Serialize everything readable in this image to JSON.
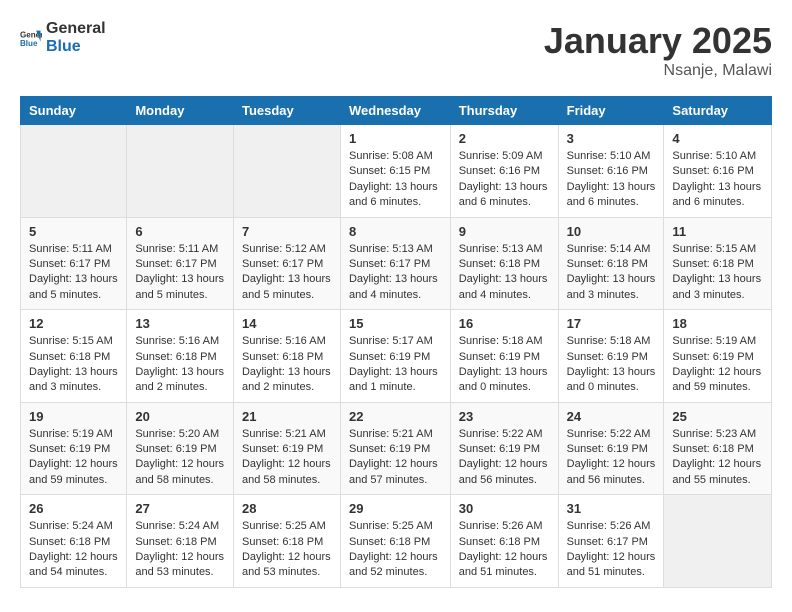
{
  "header": {
    "logo_general": "General",
    "logo_blue": "Blue",
    "month_title": "January 2025",
    "location": "Nsanje, Malawi"
  },
  "weekdays": [
    "Sunday",
    "Monday",
    "Tuesday",
    "Wednesday",
    "Thursday",
    "Friday",
    "Saturday"
  ],
  "weeks": [
    [
      {
        "day": "",
        "sunrise": "",
        "sunset": "",
        "daylight": ""
      },
      {
        "day": "",
        "sunrise": "",
        "sunset": "",
        "daylight": ""
      },
      {
        "day": "",
        "sunrise": "",
        "sunset": "",
        "daylight": ""
      },
      {
        "day": "1",
        "sunrise": "Sunrise: 5:08 AM",
        "sunset": "Sunset: 6:15 PM",
        "daylight": "Daylight: 13 hours and 6 minutes."
      },
      {
        "day": "2",
        "sunrise": "Sunrise: 5:09 AM",
        "sunset": "Sunset: 6:16 PM",
        "daylight": "Daylight: 13 hours and 6 minutes."
      },
      {
        "day": "3",
        "sunrise": "Sunrise: 5:10 AM",
        "sunset": "Sunset: 6:16 PM",
        "daylight": "Daylight: 13 hours and 6 minutes."
      },
      {
        "day": "4",
        "sunrise": "Sunrise: 5:10 AM",
        "sunset": "Sunset: 6:16 PM",
        "daylight": "Daylight: 13 hours and 6 minutes."
      }
    ],
    [
      {
        "day": "5",
        "sunrise": "Sunrise: 5:11 AM",
        "sunset": "Sunset: 6:17 PM",
        "daylight": "Daylight: 13 hours and 5 minutes."
      },
      {
        "day": "6",
        "sunrise": "Sunrise: 5:11 AM",
        "sunset": "Sunset: 6:17 PM",
        "daylight": "Daylight: 13 hours and 5 minutes."
      },
      {
        "day": "7",
        "sunrise": "Sunrise: 5:12 AM",
        "sunset": "Sunset: 6:17 PM",
        "daylight": "Daylight: 13 hours and 5 minutes."
      },
      {
        "day": "8",
        "sunrise": "Sunrise: 5:13 AM",
        "sunset": "Sunset: 6:17 PM",
        "daylight": "Daylight: 13 hours and 4 minutes."
      },
      {
        "day": "9",
        "sunrise": "Sunrise: 5:13 AM",
        "sunset": "Sunset: 6:18 PM",
        "daylight": "Daylight: 13 hours and 4 minutes."
      },
      {
        "day": "10",
        "sunrise": "Sunrise: 5:14 AM",
        "sunset": "Sunset: 6:18 PM",
        "daylight": "Daylight: 13 hours and 3 minutes."
      },
      {
        "day": "11",
        "sunrise": "Sunrise: 5:15 AM",
        "sunset": "Sunset: 6:18 PM",
        "daylight": "Daylight: 13 hours and 3 minutes."
      }
    ],
    [
      {
        "day": "12",
        "sunrise": "Sunrise: 5:15 AM",
        "sunset": "Sunset: 6:18 PM",
        "daylight": "Daylight: 13 hours and 3 minutes."
      },
      {
        "day": "13",
        "sunrise": "Sunrise: 5:16 AM",
        "sunset": "Sunset: 6:18 PM",
        "daylight": "Daylight: 13 hours and 2 minutes."
      },
      {
        "day": "14",
        "sunrise": "Sunrise: 5:16 AM",
        "sunset": "Sunset: 6:18 PM",
        "daylight": "Daylight: 13 hours and 2 minutes."
      },
      {
        "day": "15",
        "sunrise": "Sunrise: 5:17 AM",
        "sunset": "Sunset: 6:19 PM",
        "daylight": "Daylight: 13 hours and 1 minute."
      },
      {
        "day": "16",
        "sunrise": "Sunrise: 5:18 AM",
        "sunset": "Sunset: 6:19 PM",
        "daylight": "Daylight: 13 hours and 0 minutes."
      },
      {
        "day": "17",
        "sunrise": "Sunrise: 5:18 AM",
        "sunset": "Sunset: 6:19 PM",
        "daylight": "Daylight: 13 hours and 0 minutes."
      },
      {
        "day": "18",
        "sunrise": "Sunrise: 5:19 AM",
        "sunset": "Sunset: 6:19 PM",
        "daylight": "Daylight: 12 hours and 59 minutes."
      }
    ],
    [
      {
        "day": "19",
        "sunrise": "Sunrise: 5:19 AM",
        "sunset": "Sunset: 6:19 PM",
        "daylight": "Daylight: 12 hours and 59 minutes."
      },
      {
        "day": "20",
        "sunrise": "Sunrise: 5:20 AM",
        "sunset": "Sunset: 6:19 PM",
        "daylight": "Daylight: 12 hours and 58 minutes."
      },
      {
        "day": "21",
        "sunrise": "Sunrise: 5:21 AM",
        "sunset": "Sunset: 6:19 PM",
        "daylight": "Daylight: 12 hours and 58 minutes."
      },
      {
        "day": "22",
        "sunrise": "Sunrise: 5:21 AM",
        "sunset": "Sunset: 6:19 PM",
        "daylight": "Daylight: 12 hours and 57 minutes."
      },
      {
        "day": "23",
        "sunrise": "Sunrise: 5:22 AM",
        "sunset": "Sunset: 6:19 PM",
        "daylight": "Daylight: 12 hours and 56 minutes."
      },
      {
        "day": "24",
        "sunrise": "Sunrise: 5:22 AM",
        "sunset": "Sunset: 6:19 PM",
        "daylight": "Daylight: 12 hours and 56 minutes."
      },
      {
        "day": "25",
        "sunrise": "Sunrise: 5:23 AM",
        "sunset": "Sunset: 6:18 PM",
        "daylight": "Daylight: 12 hours and 55 minutes."
      }
    ],
    [
      {
        "day": "26",
        "sunrise": "Sunrise: 5:24 AM",
        "sunset": "Sunset: 6:18 PM",
        "daylight": "Daylight: 12 hours and 54 minutes."
      },
      {
        "day": "27",
        "sunrise": "Sunrise: 5:24 AM",
        "sunset": "Sunset: 6:18 PM",
        "daylight": "Daylight: 12 hours and 53 minutes."
      },
      {
        "day": "28",
        "sunrise": "Sunrise: 5:25 AM",
        "sunset": "Sunset: 6:18 PM",
        "daylight": "Daylight: 12 hours and 53 minutes."
      },
      {
        "day": "29",
        "sunrise": "Sunrise: 5:25 AM",
        "sunset": "Sunset: 6:18 PM",
        "daylight": "Daylight: 12 hours and 52 minutes."
      },
      {
        "day": "30",
        "sunrise": "Sunrise: 5:26 AM",
        "sunset": "Sunset: 6:18 PM",
        "daylight": "Daylight: 12 hours and 51 minutes."
      },
      {
        "day": "31",
        "sunrise": "Sunrise: 5:26 AM",
        "sunset": "Sunset: 6:17 PM",
        "daylight": "Daylight: 12 hours and 51 minutes."
      },
      {
        "day": "",
        "sunrise": "",
        "sunset": "",
        "daylight": ""
      }
    ]
  ]
}
